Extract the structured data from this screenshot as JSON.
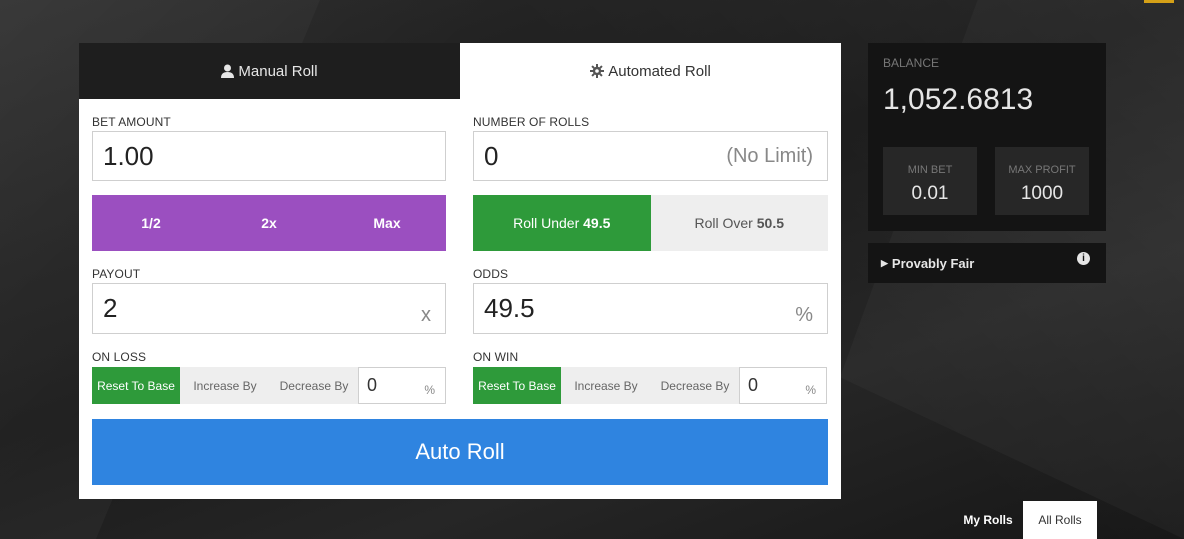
{
  "tabs": {
    "manual": "Manual Roll",
    "automated": "Automated Roll"
  },
  "bet": {
    "label": "BET AMOUNT",
    "value": "1.00",
    "buttons": [
      "1/2",
      "2x",
      "Max"
    ]
  },
  "rolls": {
    "label": "NUMBER OF ROLLS",
    "value": "0",
    "hint": "(No Limit)"
  },
  "roll_under": {
    "label": "Roll Under",
    "value": "49.5"
  },
  "roll_over": {
    "label": "Roll Over",
    "value": "50.5"
  },
  "payout": {
    "label": "PAYOUT",
    "value": "2",
    "suffix": "x"
  },
  "odds": {
    "label": "ODDS",
    "value": "49.5",
    "suffix": "%"
  },
  "on_loss": {
    "label": "ON LOSS",
    "reset": "Reset To Base",
    "increase": "Increase By",
    "decrease": "Decrease By",
    "value": "0",
    "suffix": "%"
  },
  "on_win": {
    "label": "ON WIN",
    "reset": "Reset To Base",
    "increase": "Increase By",
    "decrease": "Decrease By",
    "value": "0",
    "suffix": "%"
  },
  "auto_roll": "Auto Roll",
  "balance": {
    "label": "BALANCE",
    "value": "1,052.6813",
    "min_bet_label": "MIN BET",
    "min_bet": "0.01",
    "max_profit_label": "MAX PROFIT",
    "max_profit": "1000"
  },
  "provably_fair": "Provably Fair",
  "roll_tabs": {
    "my": "My Rolls",
    "all": "All Rolls"
  },
  "colors": {
    "green": "#2e9a3a",
    "purple": "#9b4fc0",
    "blue": "#2f84e0",
    "dark": "#1e1e1e"
  },
  "icons": [
    "user-icon",
    "gear-icon",
    "caret-right-icon",
    "info-icon"
  ]
}
